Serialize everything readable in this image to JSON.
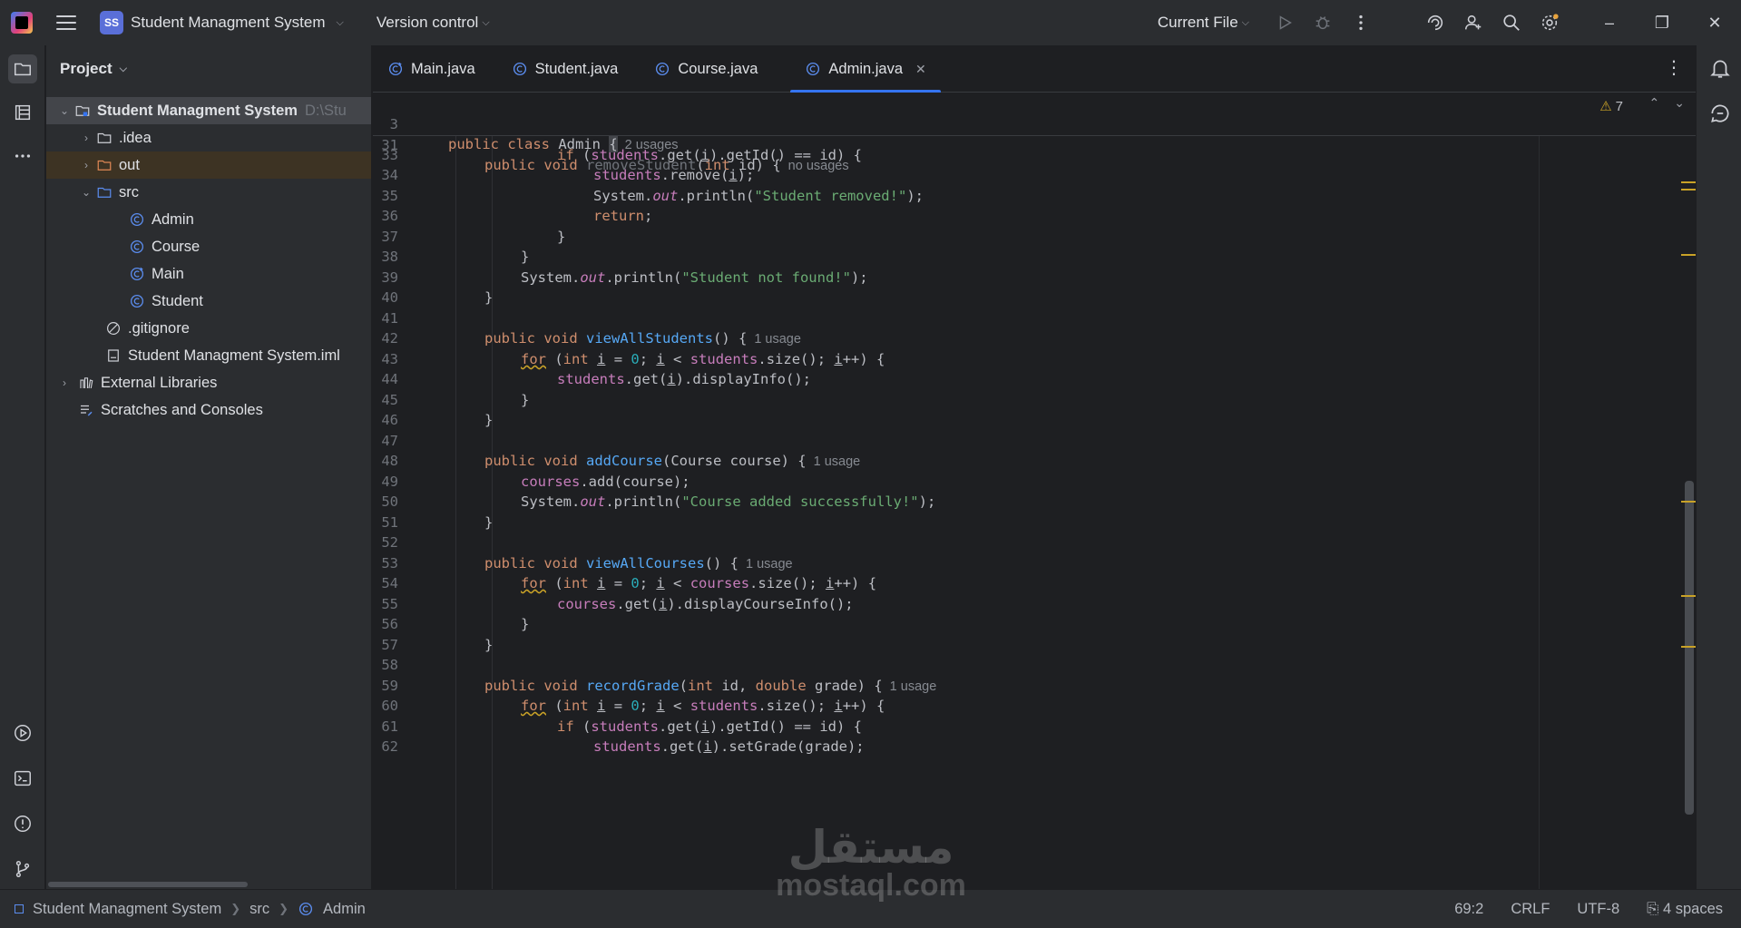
{
  "titlebar": {
    "project_badge": "SS",
    "project_name": "Student Managment System",
    "vcs_label": "Version control",
    "run_config": "Current File"
  },
  "project_panel": {
    "title": "Project",
    "tree": [
      {
        "label": "Student Managment System",
        "path": "D:\\Stu",
        "type": "module"
      },
      {
        "label": ".idea",
        "type": "folder"
      },
      {
        "label": "out",
        "type": "folder-excluded"
      },
      {
        "label": "src",
        "type": "folder-src"
      },
      {
        "label": "Admin",
        "type": "class"
      },
      {
        "label": "Course",
        "type": "class"
      },
      {
        "label": "Main",
        "type": "class-main"
      },
      {
        "label": "Student",
        "type": "class"
      },
      {
        "label": ".gitignore",
        "type": "ignore"
      },
      {
        "label": "Student Managment System.iml",
        "type": "iml"
      },
      {
        "label": "External Libraries",
        "type": "libraries"
      },
      {
        "label": "Scratches and Consoles",
        "type": "scratches"
      }
    ]
  },
  "tabs": [
    {
      "label": "Main.java"
    },
    {
      "label": "Student.java"
    },
    {
      "label": "Course.java"
    },
    {
      "label": "Admin.java",
      "active": true
    }
  ],
  "editor": {
    "warnings_count": "7",
    "sticky": [
      {
        "num": "3",
        "hint": "2 usages"
      },
      {
        "num": "31",
        "hint": "no usages"
      }
    ],
    "lines": [
      {
        "num": "33"
      },
      {
        "num": "34"
      },
      {
        "num": "35"
      },
      {
        "num": "36"
      },
      {
        "num": "37"
      },
      {
        "num": "38"
      },
      {
        "num": "39"
      },
      {
        "num": "40"
      },
      {
        "num": "41"
      },
      {
        "num": "42",
        "hint": "1 usage"
      },
      {
        "num": "43"
      },
      {
        "num": "44"
      },
      {
        "num": "45"
      },
      {
        "num": "46"
      },
      {
        "num": "47"
      },
      {
        "num": "48",
        "hint": "1 usage"
      },
      {
        "num": "49"
      },
      {
        "num": "50"
      },
      {
        "num": "51"
      },
      {
        "num": "52"
      },
      {
        "num": "53",
        "hint": "1 usage"
      },
      {
        "num": "54"
      },
      {
        "num": "55"
      },
      {
        "num": "56"
      },
      {
        "num": "57"
      },
      {
        "num": "58"
      },
      {
        "num": "59",
        "hint": "1 usage"
      },
      {
        "num": "60"
      },
      {
        "num": "61"
      },
      {
        "num": "62"
      }
    ]
  },
  "statusbar": {
    "crumbs": [
      "Student Managment System",
      "src",
      "Admin"
    ],
    "position": "69:2",
    "line_separator": "CRLF",
    "encoding": "UTF-8",
    "indent": "4 spaces"
  },
  "watermark": {
    "arabic": "مستقل",
    "latin": "mostaql.com"
  },
  "colors": {
    "accent": "#3574f0",
    "keyword": "#cf8e6d",
    "function": "#56a8f5",
    "string": "#6aab73",
    "field": "#c77dbb",
    "number": "#2aacb8",
    "warning": "#c9a227"
  }
}
